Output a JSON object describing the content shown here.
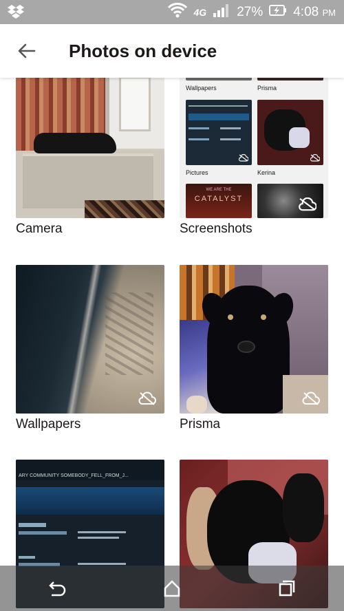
{
  "status_bar": {
    "network": "4G",
    "battery": "27%",
    "time": "4:08",
    "ampm": "PM"
  },
  "app_bar": {
    "title": "Photos on device"
  },
  "folders": [
    {
      "label": "Camera"
    },
    {
      "label": "Screenshots"
    },
    {
      "label": "Wallpapers"
    },
    {
      "label": "Prisma"
    },
    {
      "label": ""
    },
    {
      "label": ""
    }
  ],
  "screenshots_collage": {
    "labels": [
      "Wallpapers",
      "Prisma",
      "Pictures",
      "Kerina"
    ],
    "banner_text": "CATALYST",
    "banner_small": "WE ARE THE"
  },
  "screenshot_preview": {
    "header": "ARY  COMMUNITY  SOMEBODY_FELL_FROM_J..."
  },
  "colors": {
    "status_bar": "#a8a8a8",
    "nav_bar": "#3c3c3c",
    "text": "#1e1919"
  }
}
